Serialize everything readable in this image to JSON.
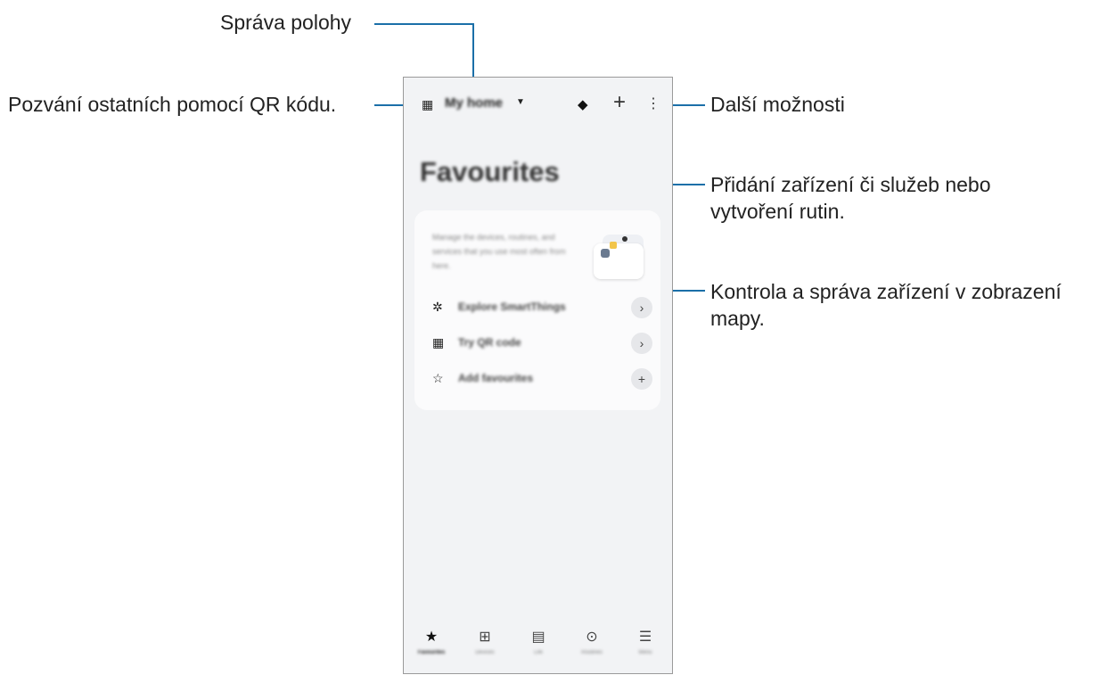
{
  "callouts": {
    "location": "Správa polohy",
    "invite": "Pozvání ostatních pomocí QR kódu.",
    "more": "Další možnosti",
    "add": [
      "Přidání zařízení či služeb nebo",
      "vytvoření rutin."
    ],
    "map": [
      "Kontrola a správa zařízení v zobrazení",
      "mapy."
    ]
  },
  "line_color": "#1b6fa8",
  "app": {
    "home_name": "My home",
    "title": "Favourites",
    "card_text": "Manage the devices, routines, and services that you use most often from here.",
    "rows": [
      {
        "icon": "smartthings-icon",
        "glyph": "✲",
        "label": "Explore SmartThings",
        "action": "›"
      },
      {
        "icon": "qr-icon",
        "glyph": "▦",
        "label": "Try QR code",
        "action": "›"
      },
      {
        "icon": "star-outline-icon",
        "glyph": "☆",
        "label": "Add favourites",
        "action": "+"
      }
    ],
    "nav": [
      {
        "icon": "star-icon",
        "glyph": "★",
        "label": "Favourites",
        "active": true
      },
      {
        "icon": "devices-icon",
        "glyph": "⊞",
        "label": "Devices",
        "active": false
      },
      {
        "icon": "life-icon",
        "glyph": "▤",
        "label": "Life",
        "active": false
      },
      {
        "icon": "routines-icon",
        "glyph": "⊙",
        "label": "Routines",
        "active": false
      },
      {
        "icon": "menu-icon",
        "glyph": "☰",
        "label": "Menu",
        "active": false
      }
    ]
  }
}
